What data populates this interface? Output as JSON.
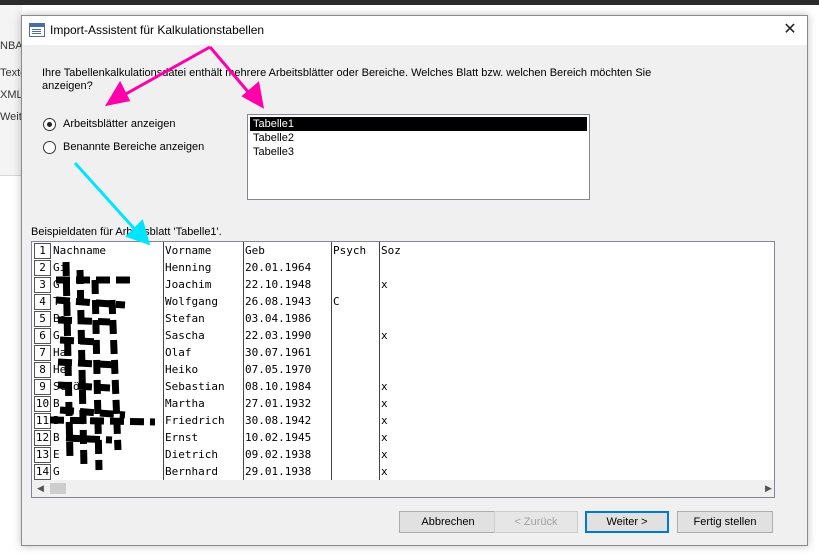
{
  "background": {
    "side_texts": [
      "NBA",
      "Texte",
      "XML",
      "Weit"
    ]
  },
  "dialog": {
    "title": "Import-Assistent für Kalkulationstabellen",
    "close_glyph": "✕",
    "question": "Ihre Tabellenkalkulationsdatei enthält mehrere Arbeitsblätter oder Bereiche. Welches Blatt bzw. welchen Bereich möchten Sie anzeigen?",
    "radio_sheets": {
      "label": "Arbeitsblätter anzeigen",
      "checked": true
    },
    "radio_ranges": {
      "label": "Benannte Bereiche anzeigen",
      "checked": false
    },
    "sheets": [
      "Tabelle1",
      "Tabelle2",
      "Tabelle3"
    ],
    "selected_sheet": "Tabelle1",
    "sample_label": "Beispieldaten für Arbeitsblatt 'Tabelle1'.",
    "table": {
      "rows": [
        [
          "1",
          "Nachname",
          "Vorname",
          "Geb",
          "Psych",
          "Soz"
        ],
        [
          "2",
          "Gi",
          "Henning",
          "20.01.1964",
          "",
          ""
        ],
        [
          "3",
          "G",
          "Joachim",
          "22.10.1948",
          "",
          "x"
        ],
        [
          "4",
          "T",
          "Wolfgang",
          "26.08.1943",
          "C",
          ""
        ],
        [
          "5",
          "Ba",
          "Stefan",
          "03.04.1986",
          "",
          ""
        ],
        [
          "6",
          "G",
          "Sascha",
          "22.03.1990",
          "",
          "x"
        ],
        [
          "7",
          "Ha",
          "Olaf",
          "30.07.1961",
          "",
          ""
        ],
        [
          "8",
          "He",
          "Heiko",
          "07.05.1970",
          "",
          ""
        ],
        [
          "9",
          "Schö",
          "Sebastian",
          "08.10.1984",
          "",
          "x"
        ],
        [
          "10",
          "B",
          "Martha",
          "27.01.1932",
          "",
          "x"
        ],
        [
          "11",
          "B",
          "Friedrich",
          "30.08.1942",
          "",
          "x"
        ],
        [
          "12",
          "B",
          "Ernst",
          "10.02.1945",
          "",
          "x"
        ],
        [
          "13",
          "E",
          "Dietrich",
          "09.02.1938",
          "",
          "x"
        ],
        [
          "14",
          "G",
          "Bernhard",
          "29.01.1938",
          "",
          "x"
        ]
      ]
    },
    "buttons": {
      "cancel": "Abbrechen",
      "back": "< Zurück",
      "next": "Weiter >",
      "finish": "Fertig stellen"
    }
  },
  "colors": {
    "dialog_bg": "#f0f0f0",
    "annotation_magenta": "#ff00aa",
    "annotation_cyan": "#00e5ff",
    "redaction": "#000000",
    "selection": "#000000"
  }
}
